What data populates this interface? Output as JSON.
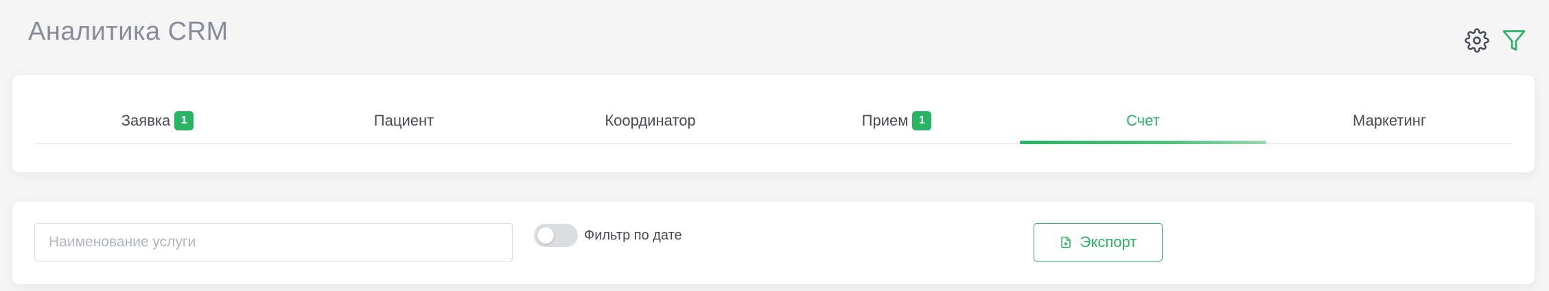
{
  "header": {
    "title": "Аналитика CRM",
    "settings_icon": "gear-icon",
    "filter_icon": "funnel-icon"
  },
  "tabs": [
    {
      "label": "Заявка",
      "badge": "1",
      "active": false
    },
    {
      "label": "Пациент",
      "badge": null,
      "active": false
    },
    {
      "label": "Координатор",
      "badge": null,
      "active": false
    },
    {
      "label": "Прием",
      "badge": "1",
      "active": false
    },
    {
      "label": "Счет",
      "badge": null,
      "active": true
    },
    {
      "label": "Маркетинг",
      "badge": null,
      "active": false
    }
  ],
  "filters": {
    "search": {
      "placeholder": "Наименование услуги",
      "value": ""
    },
    "date_filter": {
      "label": "Фильтр по дате",
      "enabled": false
    },
    "export": {
      "label": "Экспорт",
      "icon": "file-plus-icon"
    }
  },
  "colors": {
    "accent": "#28b463",
    "title": "#8a8a99",
    "text": "#4a4a55",
    "background": "#f5f5f6"
  }
}
